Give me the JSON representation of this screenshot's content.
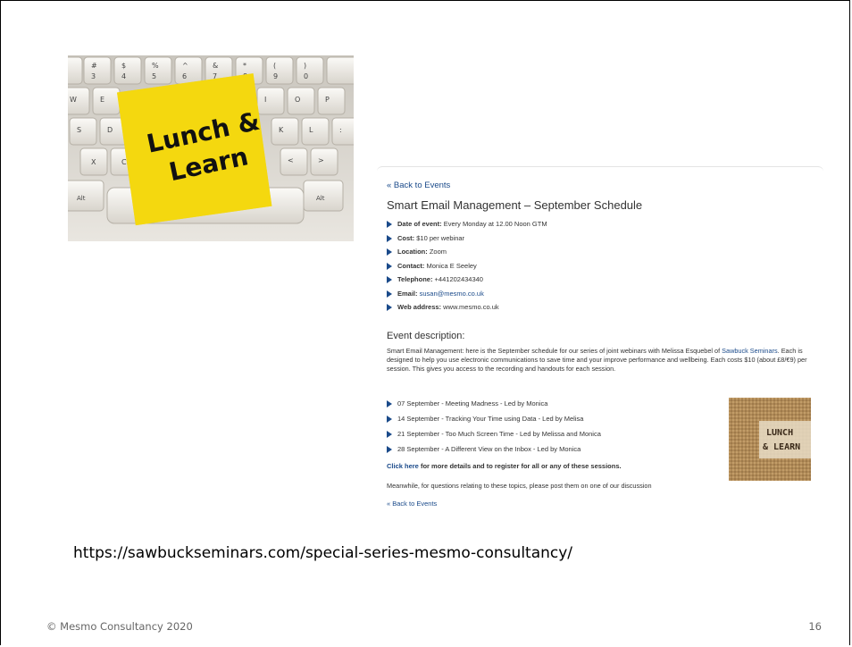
{
  "hero_image": {
    "note_text_line1": "Lunch &",
    "note_text_line2": "Learn",
    "note_color": "#f5d90a",
    "key_labels": [
      {
        "top": "#",
        "bottom": "3"
      },
      {
        "top": "$",
        "bottom": "4"
      },
      {
        "top": "%",
        "bottom": "5"
      },
      {
        "top": "^",
        "bottom": "6"
      },
      {
        "top": "&",
        "bottom": "7"
      },
      {
        "top": "*",
        "bottom": "8"
      },
      {
        "top": "(",
        "bottom": "9"
      },
      {
        "top": ")",
        "bottom": "0"
      }
    ],
    "row2_keys": [
      "W",
      "E",
      "I",
      "O",
      "P"
    ],
    "row3_keys": [
      "S",
      "D",
      "K",
      "L",
      ":"
    ],
    "row4_keys": [
      "X",
      "C",
      "<",
      ">"
    ],
    "alt_left": "Alt",
    "alt_right": "Alt"
  },
  "webpage": {
    "back_link": "« Back to Events",
    "title": "Smart Email Management – September Schedule",
    "details": [
      {
        "label": "Date of event:",
        "value": "Every Monday at 12.00 Noon GTM"
      },
      {
        "label": "Cost:",
        "value": "$10 per webinar"
      },
      {
        "label": "Location:",
        "value": "Zoom"
      },
      {
        "label": "Contact:",
        "value": "Monica E Seeley"
      },
      {
        "label": "Telephone:",
        "value": "+441202434340"
      },
      {
        "label": "Email:",
        "value": "susan@mesmo.co.uk"
      },
      {
        "label": "Web address:",
        "value": "www.mesmo.co.uk"
      }
    ],
    "description_heading": "Event description:",
    "description_part1": "Smart Email Management: here is the September schedule for our series of joint webinars with Melissa Esquebel of ",
    "description_link": "Sawbuck Seminars",
    "description_part2": ".  Each is designed to help you use electronic communications to save time and your improve performance and wellbeing. Each costs $10 (about £8/€9) per session. This gives you access to the recording and handouts for each session.",
    "sessions": [
      "07 September - Meeting Madness - Led by Monica",
      "14 September - Tracking Your Time using Data - Led by Melisa",
      "21 September - Too Much Screen Time - Led by Melissa and Monica",
      "28 September - A Different View on the Inbox - Led by Monica"
    ],
    "click_link": "Click here",
    "click_rest": " for more details and to register for all or any of these sessions.",
    "meanwhile": "Meanwhile, for questions relating to these topics, please post them on one of our discussion",
    "cutoff_link": "« Back to Events",
    "burlap_line1": "LUNCH",
    "burlap_line2": "& LEARN",
    "accent_color": "#1a4a8a"
  },
  "caption_url": "https://sawbuckseminars.com/special-series-mesmo-consultancy/",
  "footer": {
    "copyright": "© Mesmo Consultancy 2020",
    "page_number": "16"
  }
}
